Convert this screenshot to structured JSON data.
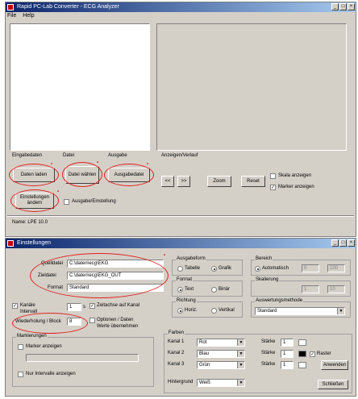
{
  "window1": {
    "title": "Rapid PC-Lab Converter - ECG Analyzer",
    "menu": [
      "File",
      "Help"
    ],
    "labels": {
      "group_a": "Eingabedaten",
      "group_b": "Datei",
      "group_c": "Ausgabe",
      "group_d": "Anzeigen/Verlauf"
    },
    "buttons": {
      "load_data": "Daten laden",
      "select_file": "Datei wählen",
      "output": "Ausgabedatei",
      "settings": "Einstellungen ändern",
      "prev": "<<",
      "next": ">>",
      "zoom": "Zoom",
      "reset": "Reset"
    },
    "checkboxes": {
      "extra_option": "Ausgabe/Einstellung",
      "show_scale": "Skala anzeigen",
      "show_markers": "Marker anzeigen"
    },
    "status": "Name: LPE 10.0"
  },
  "window2": {
    "title": "Einstellungen",
    "fields": {
      "source_label": "Quelldatei",
      "source_value": "C:\\daten\\ecg\\EKG",
      "target_label": "Zieldatei",
      "target_value": "C:\\daten\\ecg\\EKG_OUT",
      "format_label": "Format",
      "format_value": "Standard"
    },
    "left_opts": {
      "interval_label": "Intervall",
      "interval_value": "1",
      "interval_unit": "s",
      "repeat_label": "Wiederholung / Block",
      "repeat_value": "8",
      "chk1": "Kanäle",
      "chk2": "Zeitachse auf Kanal",
      "chk3": "Optionen / Daten",
      "chk4": "Werte übernehmen"
    },
    "groups": {
      "ausgabe": "Ausgabeform",
      "ausgabe_r1": "Tabelle",
      "ausgabe_r2": "Grafik",
      "format": "Format",
      "format_r1": "Text",
      "format_r2": "Binär",
      "richtung": "Richtung",
      "richtung_r1": "Horiz.",
      "richtung_r2": "Vertikal",
      "bereich": "Bereich",
      "bereich_r1": "Automatisch",
      "bereich_min": "0",
      "bereich_max": "100",
      "skalierung": "Skalierung",
      "skal_v1": "1",
      "skal_v2": "10",
      "methode": "Auswertungsmethode",
      "methode_value": "Standard",
      "marker": "Markierungen",
      "marker_chk1": "Marker anzeigen",
      "marker_chk2": "Nur Intervalle anzeigen",
      "farben": "Farben",
      "row1_label": "Kanal 1",
      "row1_value": "Rot",
      "row2_label": "Kanal 2",
      "row2_value": "Blau",
      "row3_label": "Kanal 3",
      "row3_value": "Grün",
      "row4_label": "Hintergrund",
      "row4_value": "Weiß",
      "st1_label": "Stärke",
      "st1_value": "1",
      "st2_label": "Stärke",
      "st2_value": "1",
      "st3_label": "Stärke",
      "st3_value": "1",
      "chk_grid": "Raster",
      "btn_apply": "Anwenden",
      "btn_ok": "Schließen"
    }
  }
}
